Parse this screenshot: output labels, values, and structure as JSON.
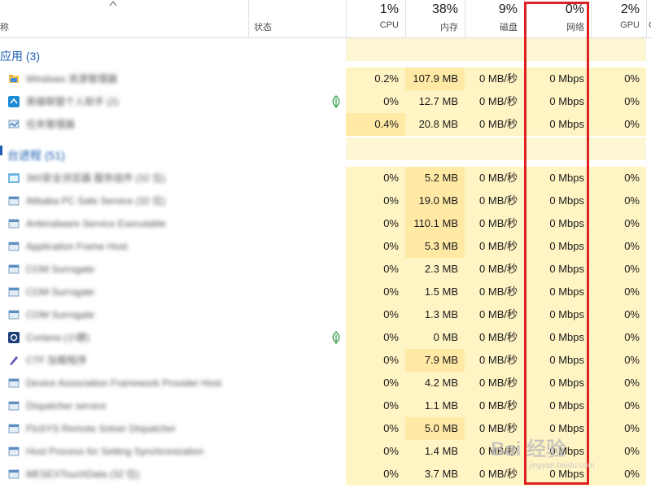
{
  "header": {
    "name_label": "称",
    "status_label": "状态",
    "cpu": {
      "pct": "1%",
      "label": "CPU"
    },
    "mem": {
      "pct": "38%",
      "label": "内存"
    },
    "disk": {
      "pct": "9%",
      "label": "磁盘"
    },
    "net": {
      "pct": "0%",
      "label": "网络"
    },
    "gpu": {
      "pct": "2%",
      "label": "GPU"
    },
    "edge_label": "C"
  },
  "groups": {
    "apps": "应用 (3)",
    "background": "台进程 (51)"
  },
  "apps": [
    {
      "name": "Windows 资源管理器",
      "cpu": "0.2%",
      "mem": "107.9 MB",
      "disk": "0 MB/秒",
      "net": "0 Mbps",
      "gpu": "0%"
    },
    {
      "name": "英雄联盟个人助手 (2)",
      "cpu": "0%",
      "mem": "12.7 MB",
      "disk": "0 MB/秒",
      "net": "0 Mbps",
      "gpu": "0%"
    },
    {
      "name": "任务管理器",
      "cpu": "0.4%",
      "mem": "20.8 MB",
      "disk": "0 MB/秒",
      "net": "0 Mbps",
      "gpu": "0%"
    }
  ],
  "processes": [
    {
      "name": "360安全浏览器 服务组件 (32 位)",
      "cpu": "0%",
      "mem": "5.2 MB",
      "disk": "0 MB/秒",
      "net": "0 Mbps",
      "gpu": "0%"
    },
    {
      "name": "Alibaba PC Safe Service (32 位)",
      "cpu": "0%",
      "mem": "19.0 MB",
      "disk": "0 MB/秒",
      "net": "0 Mbps",
      "gpu": "0%"
    },
    {
      "name": "Antimalware Service Executable",
      "cpu": "0%",
      "mem": "110.1 MB",
      "disk": "0 MB/秒",
      "net": "0 Mbps",
      "gpu": "0%"
    },
    {
      "name": "Application Frame Host",
      "cpu": "0%",
      "mem": "5.3 MB",
      "disk": "0 MB/秒",
      "net": "0 Mbps",
      "gpu": "0%"
    },
    {
      "name": "COM Surrogate",
      "cpu": "0%",
      "mem": "2.3 MB",
      "disk": "0 MB/秒",
      "net": "0 Mbps",
      "gpu": "0%"
    },
    {
      "name": "COM Surrogate",
      "cpu": "0%",
      "mem": "1.5 MB",
      "disk": "0 MB/秒",
      "net": "0 Mbps",
      "gpu": "0%"
    },
    {
      "name": "COM Surrogate",
      "cpu": "0%",
      "mem": "1.3 MB",
      "disk": "0 MB/秒",
      "net": "0 Mbps",
      "gpu": "0%"
    },
    {
      "name": "Cortana (小娜)",
      "cpu": "0%",
      "mem": "0 MB",
      "disk": "0 MB/秒",
      "net": "0 Mbps",
      "gpu": "0%"
    },
    {
      "name": "CTF 加载程序",
      "cpu": "0%",
      "mem": "7.9 MB",
      "disk": "0 MB/秒",
      "net": "0 Mbps",
      "gpu": "0%"
    },
    {
      "name": "Device Association Framework Provider Host",
      "cpu": "0%",
      "mem": "4.2 MB",
      "disk": "0 MB/秒",
      "net": "0 Mbps",
      "gpu": "0%"
    },
    {
      "name": "Dispatcher service",
      "cpu": "0%",
      "mem": "1.1 MB",
      "disk": "0 MB/秒",
      "net": "0 Mbps",
      "gpu": "0%"
    },
    {
      "name": "FloSYS Remote Solver Dispatcher",
      "cpu": "0%",
      "mem": "5.0 MB",
      "disk": "0 MB/秒",
      "net": "0 Mbps",
      "gpu": "0%"
    },
    {
      "name": "Host Process for Setting Synchronization",
      "cpu": "0%",
      "mem": "1.4 MB",
      "disk": "0 MB/秒",
      "net": "0 Mbps",
      "gpu": "0%"
    },
    {
      "name": "MESEXTouchData (32 位)",
      "cpu": "0%",
      "mem": "3.7 MB",
      "disk": "0 MB/秒",
      "net": "0 Mbps",
      "gpu": "0%"
    }
  ],
  "watermark": {
    "brand": "Bai  经验",
    "sub": "jingyan.baidu.com"
  },
  "colors": {
    "highlight": "#e02020",
    "group_text": "#1d5fb3",
    "cell_shade": "#fff4c4",
    "mem_shade": "#ffe9a5"
  },
  "icons": {
    "app_row": "folder-icon",
    "leaf": "efficiency-leaf-icon",
    "process": "window-icon"
  }
}
